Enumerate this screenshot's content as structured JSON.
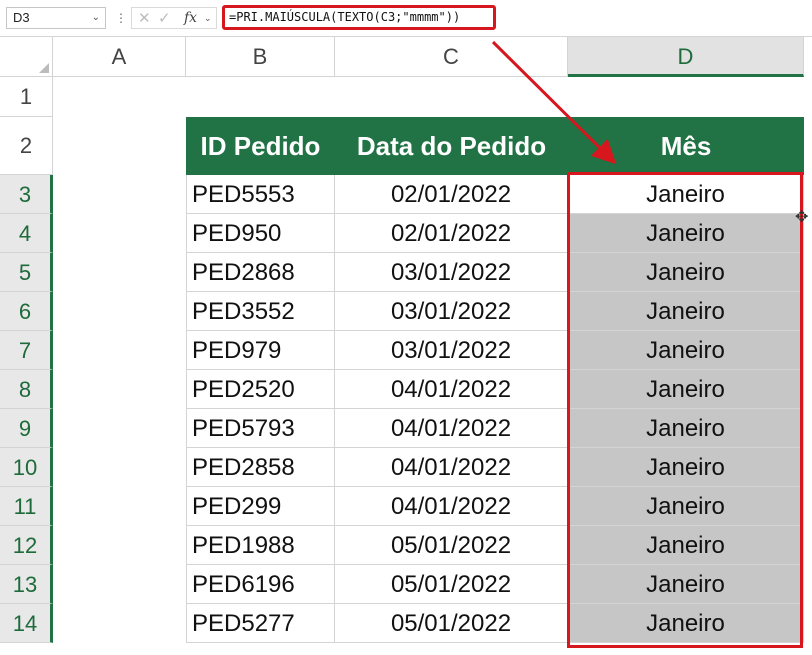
{
  "name_box": {
    "value": "D3"
  },
  "formula": {
    "text": "=PRI.MAIÚSCULA(TEXTO(C3;\"mmmm\"))"
  },
  "columns": [
    "A",
    "B",
    "C",
    "D"
  ],
  "rows": [
    "1",
    "2",
    "3",
    "4",
    "5",
    "6",
    "7",
    "8",
    "9",
    "10",
    "11",
    "12",
    "13",
    "14"
  ],
  "table": {
    "headers": [
      "ID Pedido",
      "Data do Pedido",
      "Mês"
    ],
    "rows": [
      [
        "PED5553",
        "02/01/2022",
        "Janeiro"
      ],
      [
        "PED950",
        "02/01/2022",
        "Janeiro"
      ],
      [
        "PED2868",
        "03/01/2022",
        "Janeiro"
      ],
      [
        "PED3552",
        "03/01/2022",
        "Janeiro"
      ],
      [
        "PED979",
        "03/01/2022",
        "Janeiro"
      ],
      [
        "PED2520",
        "04/01/2022",
        "Janeiro"
      ],
      [
        "PED5793",
        "04/01/2022",
        "Janeiro"
      ],
      [
        "PED2858",
        "04/01/2022",
        "Janeiro"
      ],
      [
        "PED299",
        "04/01/2022",
        "Janeiro"
      ],
      [
        "PED1988",
        "05/01/2022",
        "Janeiro"
      ],
      [
        "PED6196",
        "05/01/2022",
        "Janeiro"
      ],
      [
        "PED5277",
        "05/01/2022",
        "Janeiro"
      ]
    ]
  },
  "colors": {
    "header_green": "#217346",
    "highlight_red": "#d6171e",
    "selection_gray": "#c6c6c6"
  },
  "icons": [
    "dropdown-icon",
    "cancel-icon",
    "confirm-icon",
    "function-icon",
    "move-cursor-icon"
  ]
}
